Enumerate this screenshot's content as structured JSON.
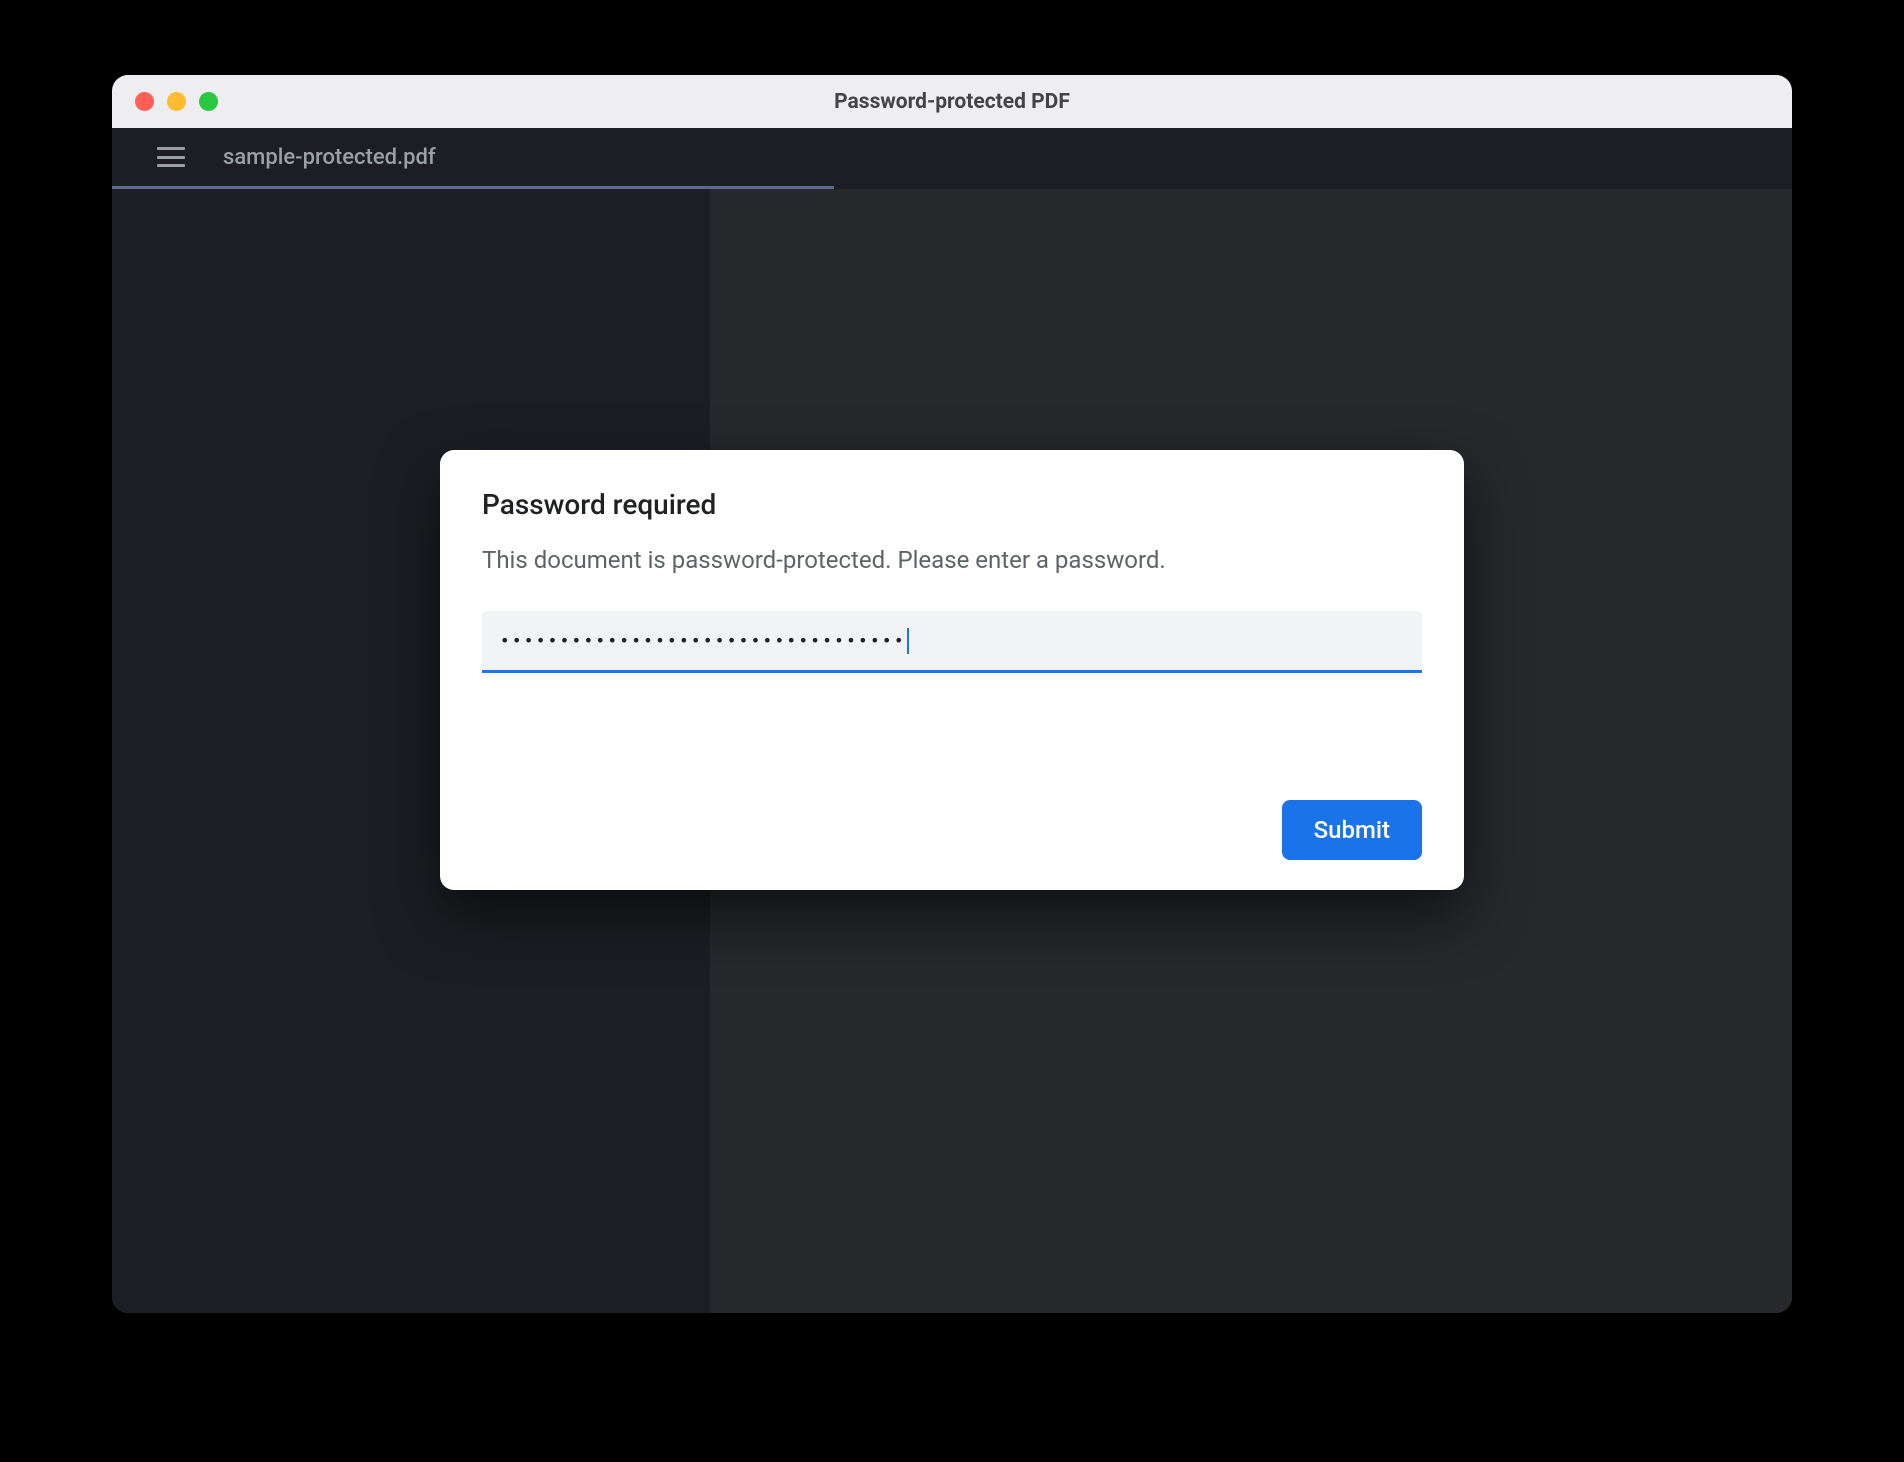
{
  "window": {
    "title": "Password-protected PDF"
  },
  "toolbar": {
    "file_name": "sample-protected.pdf"
  },
  "dialog": {
    "title": "Password required",
    "message": "This document is password-protected. Please enter a password.",
    "password_value": "••••••••••••••••••••••••••••••••••",
    "submit_label": "Submit"
  },
  "colors": {
    "accent": "#1a73e8",
    "toolbar_bg": "#1c1e23",
    "content_bg": "#26282c"
  }
}
